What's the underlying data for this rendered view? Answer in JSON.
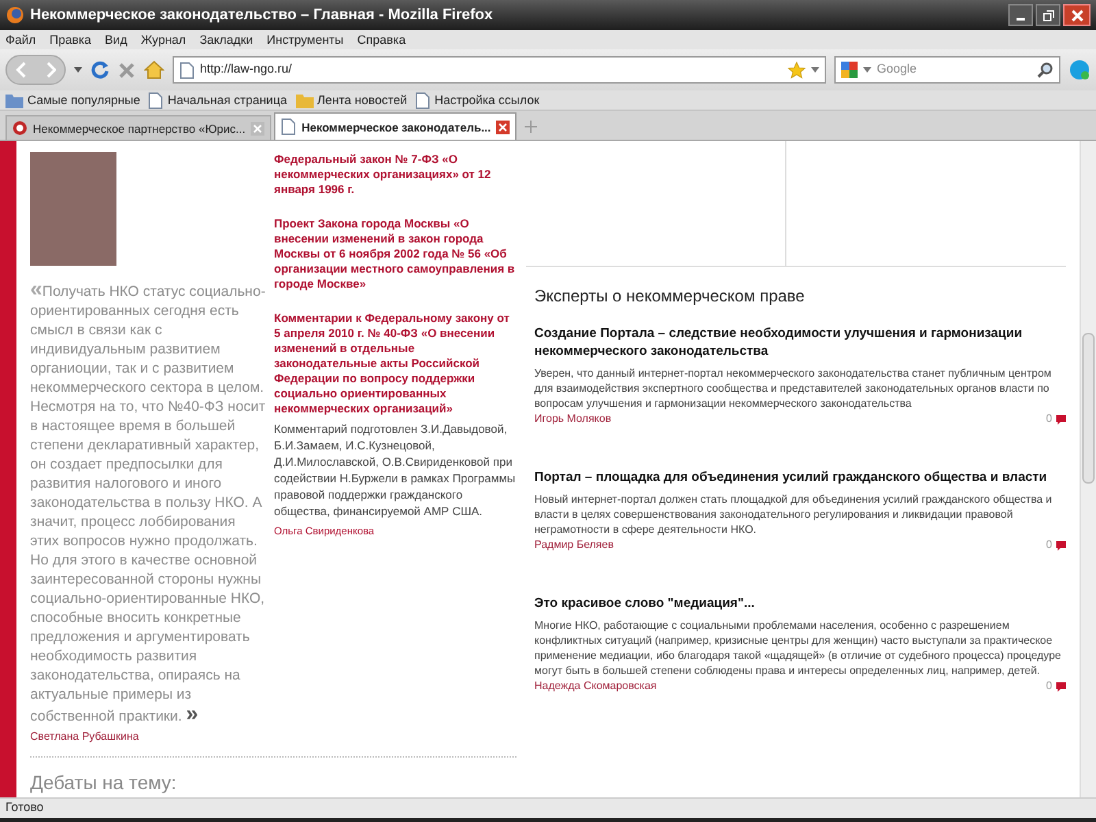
{
  "window": {
    "title": "Некоммерческое законодательство – Главная - Mozilla Firefox"
  },
  "menu": [
    "Файл",
    "Правка",
    "Вид",
    "Журнал",
    "Закладки",
    "Инструменты",
    "Справка"
  ],
  "address": {
    "value": "http://law-ngo.ru/"
  },
  "search": {
    "placeholder": "Google"
  },
  "bookmarks": [
    {
      "label": "Самые популярные",
      "kind": "smart"
    },
    {
      "label": "Начальная страница",
      "kind": "page"
    },
    {
      "label": "Лента новостей",
      "kind": "feed"
    },
    {
      "label": "Настройка ссылок",
      "kind": "page"
    }
  ],
  "tabs": [
    {
      "label": "Некоммерческое партнерство «Юрис...",
      "selected": false
    },
    {
      "label": "Некоммерческое законодатель...",
      "selected": true
    }
  ],
  "quote": {
    "open_mark": "«",
    "text": "Получать НКО статус социально-ориентированных сегодня есть смысл в связи как с индивидуальным развитием органиоции, так и с развитием некоммерческого сектора в целом. Несмотря на то, что №40-ФЗ носит в настоящее время в большей степени декларативный характер, он создает предпосылки для развития налогового и иного законодательства в пользу НКО. А значит, процесс лоббирования этих вопросов нужно продолжать. Но для этого в качестве основной заинтересованной стороны нужны социально-ориентированные НКО, способные вносить конкретные предложения и аргументировать необходимость развития законодательства, опираясь на актуальные примеры из собственной практики.",
    "close_mark": "»",
    "author": "Светлана Рубашкина"
  },
  "debate_heading": "Дебаты на тему:",
  "laws": [
    {
      "title": "Федеральный закон № 7-ФЗ «О некоммерческих организациях» от 12 января 1996 г."
    },
    {
      "title": "Проект Закона города Москвы «О внесении изменений в закон города Москвы от 6 ноября 2002 года № 56 «Об организации местного самоуправления в городе Москве»"
    },
    {
      "title": "Комментарии к Федеральному закону от 5 апреля 2010 г. № 40-ФЗ «О внесении изменений в отдельные законодательные акты Российской Федерации по вопросу поддержки социально ориентированных некоммерческих организаций»",
      "comment": "Комментарий подготовлен З.И.Давыдовой, Б.И.Замаем, И.С.Кузнецовой, Д.И.Милославской, О.В.Свириденковой при содействии Н.Буржели в рамках Программы правовой поддержки гражданского общества, финансируемой АМР США.",
      "author": "Ольга Свириденкова"
    }
  ],
  "experts": {
    "heading": "Эксперты о некоммерческом праве",
    "articles": [
      {
        "title": "Создание Портала – следствие необходимости улучшения и гармонизации некоммерческого законодательства",
        "text": "Уверен, что данный интернет-портал некоммерческого законодательства станет публичным центром для взаимодействия экспертного сообщества и представителей законодательных органов власти по вопросам улучшения и гармонизации некоммерческого законодательства",
        "author": "Игорь Моляков",
        "comments": "0"
      },
      {
        "title": "Портал – площадка для объединения усилий гражданского общества и власти",
        "text": "Новый интернет-портал должен стать площадкой для объединения усилий гражданского общества и власти в целях совершенствования законодательного регулирования и ликвидации правовой неграмотности в сфере деятельности НКО.",
        "author": "Радмир Беляев",
        "comments": "0"
      },
      {
        "title": "Это красивое слово \"медиация\"...",
        "text": "Многие НКО, работающие с социальными проблемами населения, особенно с разрешением конфликтных ситуаций (например, кризисные центры для женщин) часто выступали за практическое применение медиации, ибо благодаря такой «щадящей» (в отличие от судебного процесса) процедуре могут быть в большей степени соблюдены права и интересы определенных лиц, например, детей.",
        "author": "Надежда Скомаровская",
        "comments": "0"
      }
    ]
  },
  "status_bar": "Готово"
}
